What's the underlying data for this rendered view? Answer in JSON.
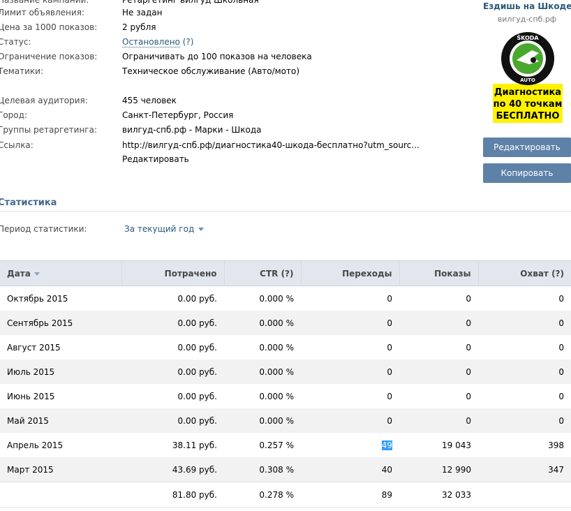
{
  "campaign": {
    "rows": [
      {
        "label": "Название кампании:",
        "value": "Ретаргетинг вилгуд Школьная",
        "link": false
      },
      {
        "label": "Лимит объявления:",
        "value": "Не задан",
        "link": true
      },
      {
        "label": "Цена за 1000 показов:",
        "value": "2 рубля",
        "link": true
      },
      {
        "label": "Статус:",
        "value": "Остановлено",
        "link": true,
        "suffix": " (?)"
      },
      {
        "label": "Ограничение показов:",
        "value": "Ограничивать до 100 показов на человека",
        "link": false
      },
      {
        "label": "Тематики:",
        "value": "Техническое обслуживание (Авто/мото)",
        "link": false
      },
      {
        "label": "Целевая аудитория:",
        "value": "455 человек",
        "link": false
      },
      {
        "label": "Город:",
        "value": "Санкт-Петербург, Россия",
        "link": false
      },
      {
        "label": "Группы ретаргетинга:",
        "value": "вилгуд-спб.рф - Марки - Шкода",
        "link": false
      },
      {
        "label": "Ссылка:",
        "value": "http://вилгуд-спб.рф/диагностика40-шкода-бесплатно?utm_sourc...",
        "link": true
      },
      {
        "label": "",
        "value": "Редактировать",
        "link": true
      }
    ]
  },
  "ad": {
    "title": "Ездишь на Шкоде?",
    "domain": "вилгуд-спб.рф",
    "logo_top": "ŠKODA",
    "logo_bottom": "AUTO",
    "text_lines": [
      "Диагностика",
      "по 40 точкам",
      "БЕСПЛАТНО"
    ],
    "edit_button": "Редактировать",
    "copy_button": "Копировать",
    "colors": {
      "banner": "#fff200",
      "logo": "#4ba82e",
      "button": "#5e81a8"
    }
  },
  "stats": {
    "section_title": "Статистика",
    "period_label": "Период статистики:",
    "period_value": "За текущий год",
    "columns": [
      "Дата",
      "Потрачено",
      "CTR (?)",
      "Переходы",
      "Показы",
      "Охват (?)"
    ],
    "rows": [
      [
        "Октябрь 2015",
        "0.00 руб.",
        "0.000 %",
        "0",
        "0",
        "0"
      ],
      [
        "Сентябрь 2015",
        "0.00 руб.",
        "0.000 %",
        "0",
        "0",
        "0"
      ],
      [
        "Август 2015",
        "0.00 руб.",
        "0.000 %",
        "0",
        "0",
        "0"
      ],
      [
        "Июль 2015",
        "0.00 руб.",
        "0.000 %",
        "0",
        "0",
        "0"
      ],
      [
        "Июнь 2015",
        "0.00 руб.",
        "0.000 %",
        "0",
        "0",
        "0"
      ],
      [
        "Май 2015",
        "0.00 руб.",
        "0.000 %",
        "0",
        "0",
        "0"
      ],
      [
        "Апрель 2015",
        "38.11 руб.",
        "0.257 %",
        "49",
        "19 043",
        "398"
      ],
      [
        "Март 2015",
        "43.69 руб.",
        "0.308 %",
        "40",
        "12 990",
        "347"
      ]
    ],
    "total": [
      "",
      "81.80 руб.",
      "0.278 %",
      "89",
      "32 033",
      ""
    ],
    "highlighted_cell": "49"
  }
}
